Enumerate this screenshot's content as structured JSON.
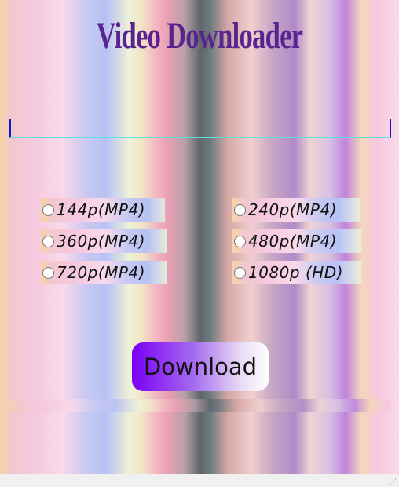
{
  "app": {
    "title": "Video Downloader"
  },
  "url_input": {
    "value": "",
    "placeholder": ""
  },
  "quality_options": [
    {
      "label": "144p(MP4)"
    },
    {
      "label": "240p(MP4)"
    },
    {
      "label": "360p(MP4)"
    },
    {
      "label": "480p(MP4)"
    },
    {
      "label": "720p(MP4)"
    },
    {
      "label": "1080p (HD)"
    }
  ],
  "download_button": {
    "label": "Download"
  },
  "colors": {
    "title": "#5a2490",
    "input_underline": "#5fe0dc",
    "input_side_borders": "#1515b8",
    "button_gradient_start": "#7a00f5",
    "button_gradient_end": "#ffffff"
  },
  "icons": {
    "resize_grip": "resize-grip-icon"
  }
}
